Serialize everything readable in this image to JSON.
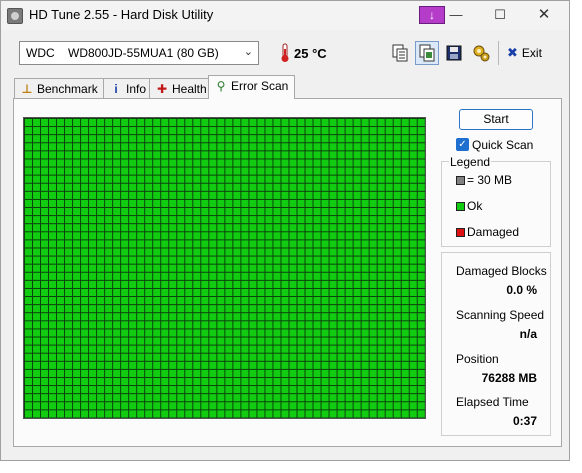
{
  "window": {
    "title": "HD Tune 2.55 - Hard Disk Utility"
  },
  "toolbar": {
    "drive_selected": "WDC    WD800JD-55MUA1 (80 GB)",
    "temperature": "25 °C",
    "buttons": [
      "copy-text-icon",
      "copy-info-icon",
      "save-icon",
      "options-icon"
    ],
    "exit_label": "Exit"
  },
  "tabs": [
    {
      "label": "Benchmark",
      "icon": "benchmark-icon",
      "active": false
    },
    {
      "label": "Info",
      "icon": "info-icon",
      "active": false
    },
    {
      "label": "Health",
      "icon": "health-icon",
      "active": false
    },
    {
      "label": "Error Scan",
      "icon": "error-scan-icon",
      "active": true
    }
  ],
  "scan": {
    "start_label": "Start",
    "quick_scan_label": "Quick Scan",
    "quick_scan_checked": true,
    "grid_status": "all ok"
  },
  "legend": {
    "title": "Legend",
    "items": [
      {
        "label": "= 30 MB",
        "color": "#808080"
      },
      {
        "label": "Ok",
        "color": "#11cc11"
      },
      {
        "label": "Damaged",
        "color": "#dd1111"
      }
    ]
  },
  "stats": {
    "damaged_blocks_label": "Damaged Blocks",
    "damaged_blocks_value": "0.0 %",
    "scanning_speed_label": "Scanning Speed",
    "scanning_speed_value": "n/a",
    "position_label": "Position",
    "position_value": "76288 MB",
    "elapsed_time_label": "Elapsed Time",
    "elapsed_time_value": "0:37"
  },
  "colors": {
    "ok": "#11cc11",
    "damaged": "#dd1111",
    "accent": "#2b74c4"
  }
}
